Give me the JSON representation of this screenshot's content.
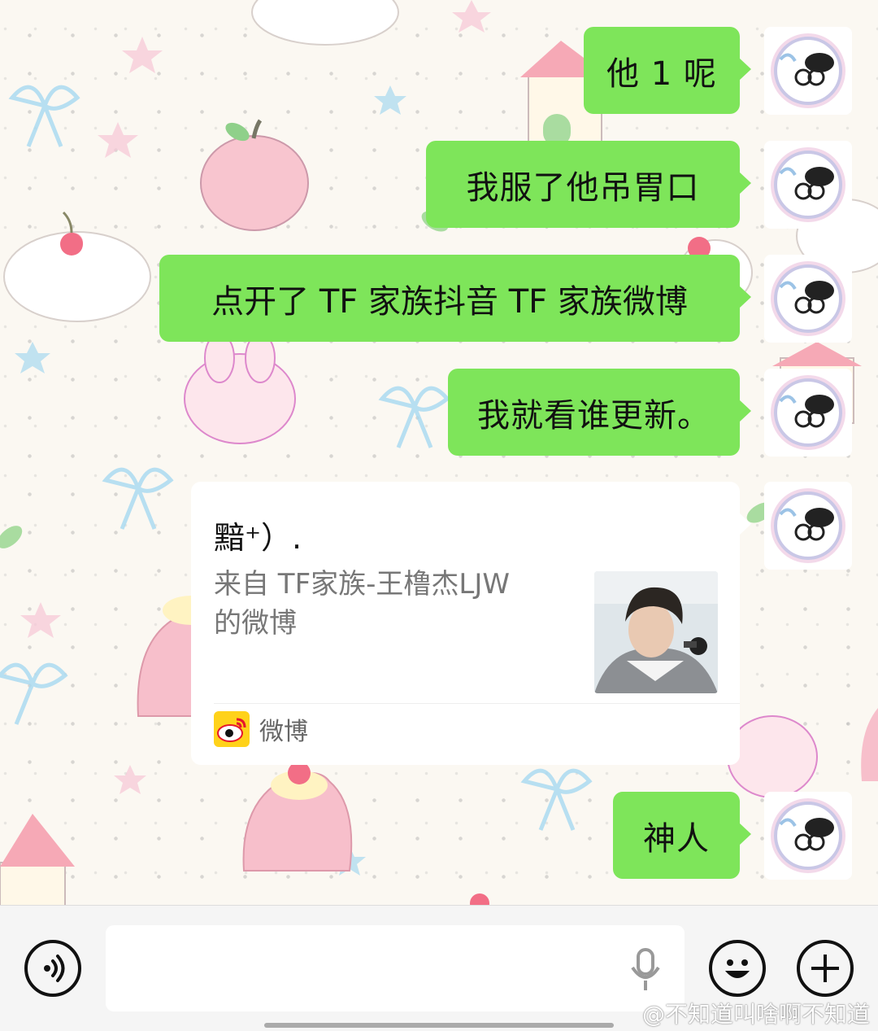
{
  "messages": [
    {
      "side": "right",
      "type": "text",
      "text": "他 1 呢"
    },
    {
      "side": "right",
      "type": "text",
      "text": "我服了他吊胃口"
    },
    {
      "side": "right",
      "type": "text",
      "text": "点开了 TF 家族抖音 TF 家族微博"
    },
    {
      "side": "right",
      "type": "text",
      "text": "我就看谁更新。"
    },
    {
      "side": "right",
      "type": "share-card",
      "card": {
        "title": "黯⁺）.",
        "desc_line1": "来自 TF家族-王橹杰LJW",
        "desc_line2": "的微博",
        "source": "微博"
      }
    },
    {
      "side": "right",
      "type": "text",
      "text": "神人"
    }
  ],
  "input_bar": {
    "text_value": "",
    "watermark": "@不知道叫啥啊不知道"
  },
  "icons": {
    "voice": "voice-toggle-icon",
    "mic": "microphone-icon",
    "emoji": "emoji-icon",
    "plus": "plus-icon",
    "weibo": "weibo-logo-icon"
  },
  "colors": {
    "bubble": "#7ee55a",
    "card": "#ffffff",
    "input_bar": "#f5f5f5"
  }
}
